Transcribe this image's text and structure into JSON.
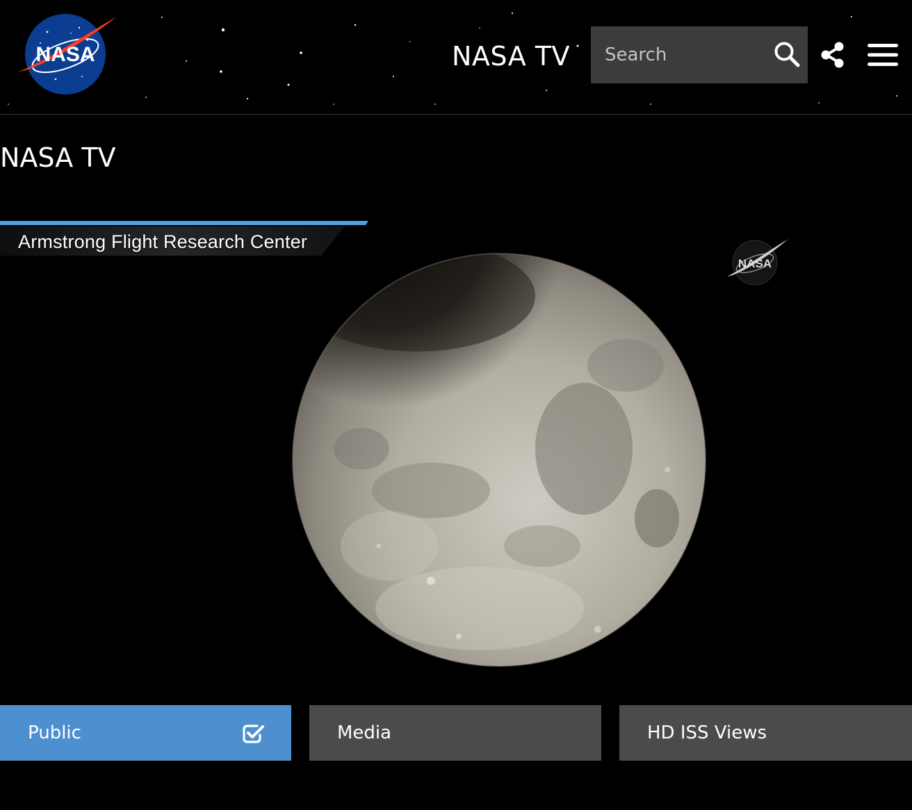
{
  "header": {
    "logo_text": "NASA",
    "title": "NASA TV",
    "search": {
      "placeholder": "Search"
    }
  },
  "page": {
    "title": "NASA TV"
  },
  "video": {
    "lower_third": "Armstrong Flight Research Center",
    "watermark_text": "NASA"
  },
  "tabs": [
    {
      "label": "Public",
      "selected": true
    },
    {
      "label": "Media",
      "selected": false
    },
    {
      "label": "HD ISS Views",
      "selected": false
    }
  ],
  "icons": {
    "search": "search-icon",
    "share": "share-icon",
    "menu": "hamburger-menu-icon",
    "selected": "check-square-icon"
  },
  "colors": {
    "background": "#000000",
    "active_tab": "#4e8fcf",
    "inactive_tab": "#4b4b4b",
    "search_box": "#3c3c3c",
    "nasa_blue": "#0b3d91",
    "nasa_red": "#fc3d21",
    "lower_third_accent": "#4aa3e6"
  }
}
